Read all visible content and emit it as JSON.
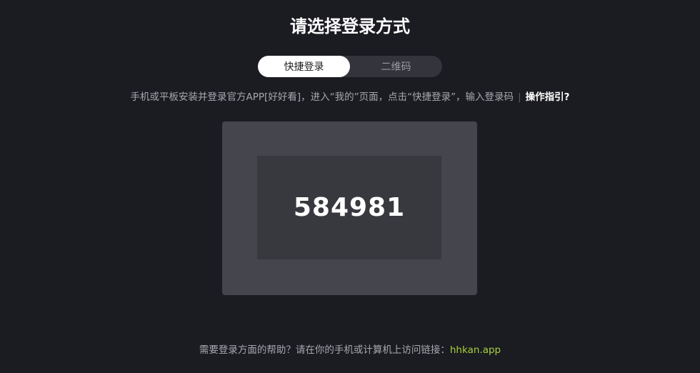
{
  "page": {
    "title": "请选择登录方式"
  },
  "tabs": [
    {
      "label": "快捷登录",
      "active": true
    },
    {
      "label": "二维码",
      "active": false
    }
  ],
  "instruction": {
    "text": "手机或平板安装并登录官方APP[好好看]，进入“我的”页面，点击“快捷登录”，输入登录码",
    "separator": "|",
    "guide_link": "操作指引?"
  },
  "login_code": {
    "value": "584981"
  },
  "help": {
    "text": "需要登录方面的帮助？请在你的手机或计算机上访问链接：",
    "link": "hhkan.app"
  },
  "colors": {
    "background": "#1b1b22",
    "panel": "#45454d",
    "code_box": "#38383f",
    "link_accent": "#a6d23a"
  }
}
